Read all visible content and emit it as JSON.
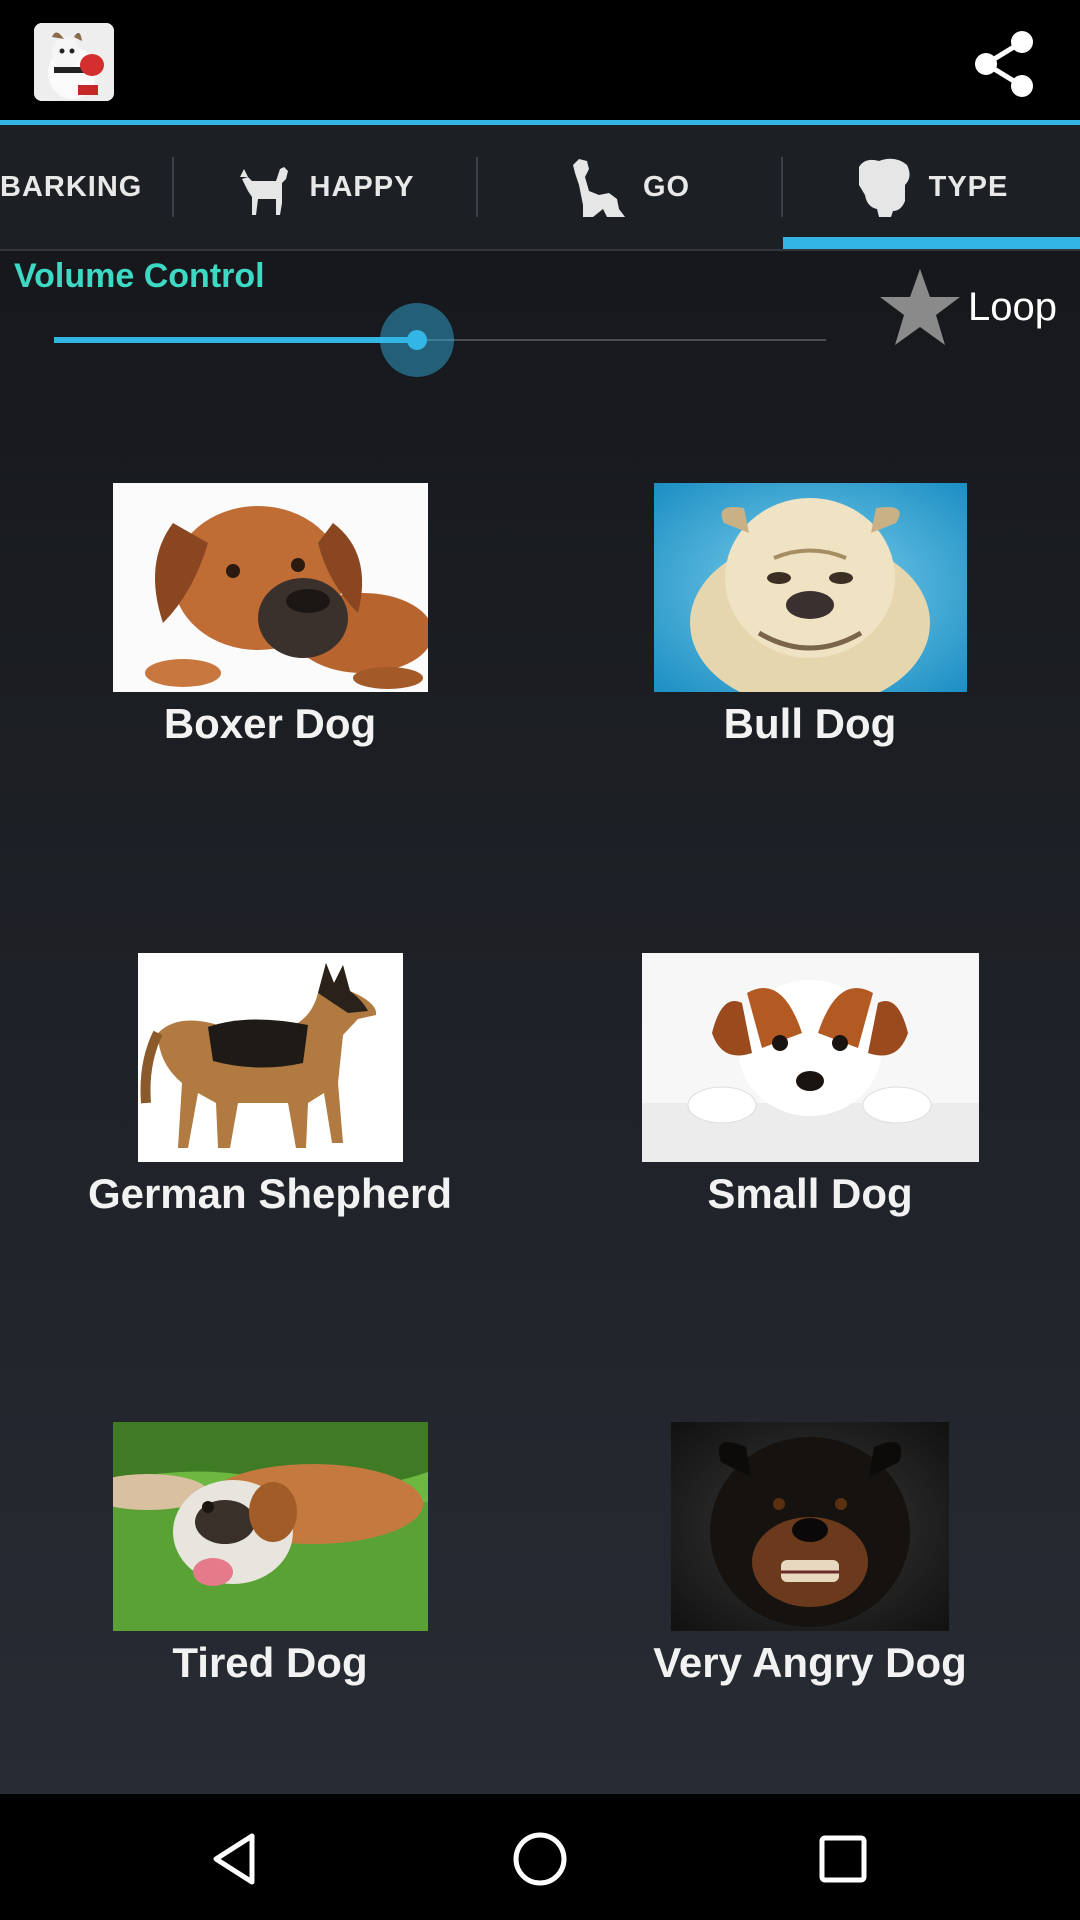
{
  "actionbar": {
    "app_icon": "dog-boxing-glove-icon",
    "share_icon": "share-icon"
  },
  "tabs": [
    {
      "label": "BARKING",
      "icon": ""
    },
    {
      "label": "HAPPY",
      "icon": "dog-standing-icon"
    },
    {
      "label": "GO",
      "icon": "dog-sitting-icon"
    },
    {
      "label": "TYPE",
      "icon": "dog-head-icon"
    }
  ],
  "active_tab": "TYPE",
  "volume": {
    "title": "Volume Control",
    "level": 0.47
  },
  "loop": {
    "label": "Loop",
    "icon": "star-icon",
    "checked": false
  },
  "dogs": [
    {
      "label": "Boxer Dog"
    },
    {
      "label": "Bull Dog"
    },
    {
      "label": "German Shepherd"
    },
    {
      "label": "Small Dog"
    },
    {
      "label": "Tired Dog"
    },
    {
      "label": "Very Angry Dog"
    }
  ],
  "colors": {
    "accent": "#33b5e5",
    "title": "#3dd9c5"
  },
  "navbar": {
    "back_icon": "back-icon",
    "home_icon": "home-icon",
    "recents_icon": "recents-icon"
  }
}
